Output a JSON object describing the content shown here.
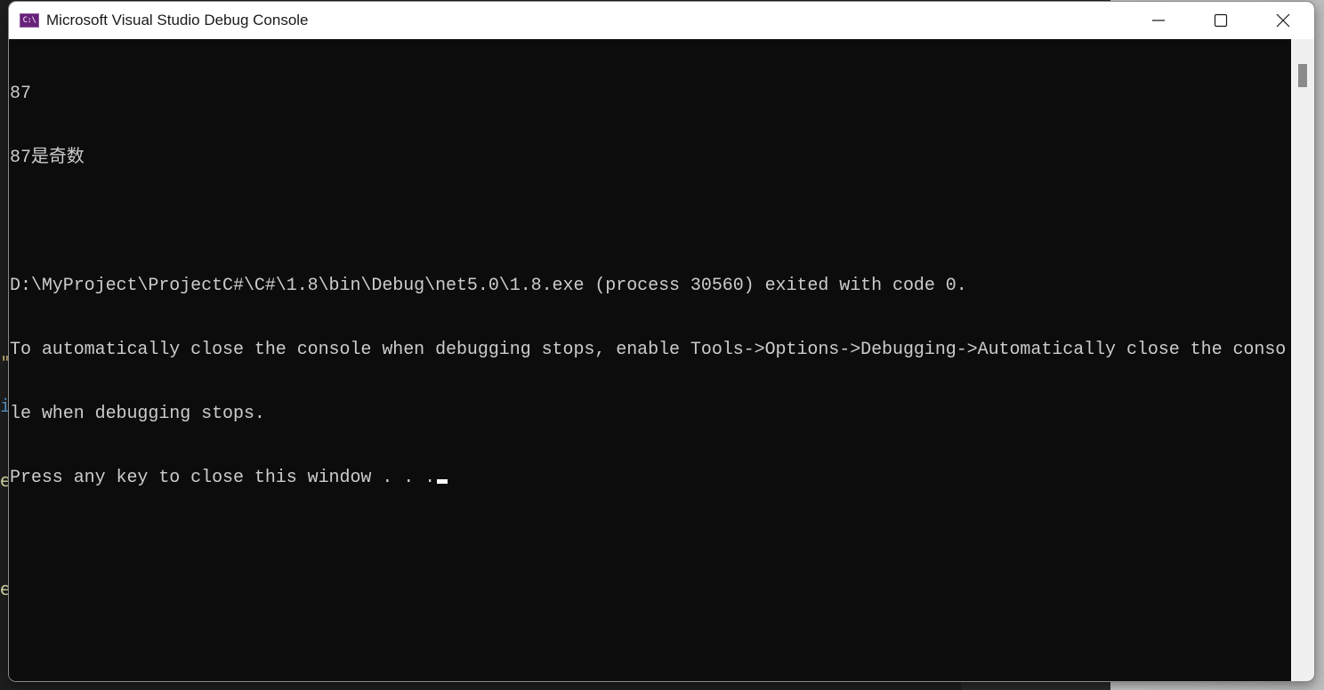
{
  "window": {
    "title": "Microsoft Visual Studio Debug Console",
    "icon": "console-app-icon",
    "icon_text": "C:\\",
    "controls": {
      "minimize": "minimize-icon",
      "maximize": "maximize-icon",
      "close": "close-icon"
    }
  },
  "console": {
    "lines": [
      "87",
      "87是奇数",
      "",
      "D:\\MyProject\\ProjectC#\\C#\\1.8\\bin\\Debug\\net5.0\\1.8.exe (process 30560) exited with code 0.",
      "To automatically close the console when debugging stops, enable Tools->Options->Debugging->Automatically close the conso",
      "le when debugging stops.",
      "Press any key to close this window . . ."
    ],
    "foreground": "#cccccc",
    "background": "#0c0c0c"
  },
  "scrollbar": {
    "position_fraction": 0.0
  },
  "background_editor": {
    "peek_glyphs": [
      {
        "text": "\"",
        "color": "#d7ba7d"
      },
      {
        "text": "i",
        "color": "#569cd6"
      },
      {
        "text": "e",
        "color": "#dcdcaa"
      },
      {
        "text": "e",
        "color": "#dcdcaa"
      }
    ]
  }
}
